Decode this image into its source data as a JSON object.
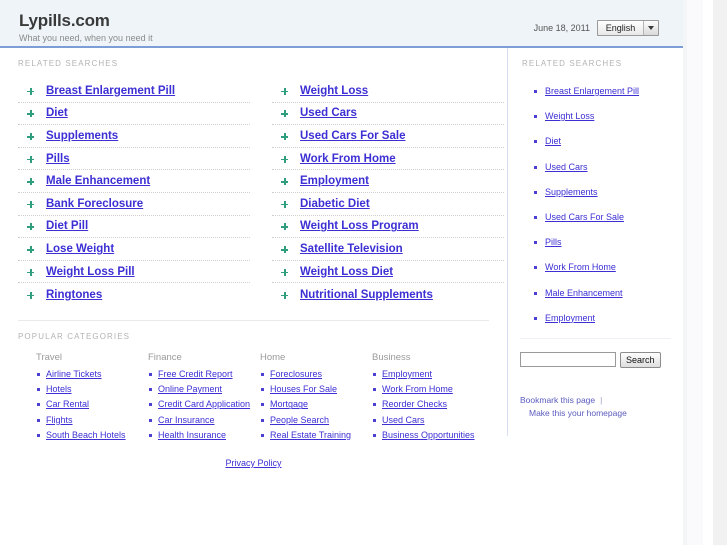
{
  "header": {
    "site_title": "Lypills.com",
    "tagline": "What you need, when you need it",
    "date": "June 18, 2011",
    "language": "English",
    "language_options": [
      "English"
    ]
  },
  "related_searches": {
    "label": "RELATED SEARCHES",
    "column_left": [
      "Breast Enlargement Pill",
      "Diet",
      "Supplements",
      "Pills",
      "Male Enhancement",
      "Bank Foreclosure",
      "Diet Pill",
      "Lose Weight",
      "Weight Loss Pill",
      "Ringtones"
    ],
    "column_right": [
      "Weight Loss",
      "Used Cars",
      "Used Cars For Sale",
      "Work From Home",
      "Employment",
      "Diabetic Diet",
      "Weight Loss Program",
      "Satellite Television",
      "Weight Loss Diet",
      "Nutritional Supplements"
    ]
  },
  "popular_categories": {
    "label": "POPULAR CATEGORIES",
    "groups": [
      {
        "title": "Travel",
        "items": [
          "Airline Tickets",
          "Hotels",
          "Car Rental",
          "Flights",
          "South Beach Hotels"
        ]
      },
      {
        "title": "Finance",
        "items": [
          "Free Credit Report",
          "Online Payment",
          "Credit Card Application",
          "Car Insurance",
          "Health Insurance"
        ]
      },
      {
        "title": "Home",
        "items": [
          "Foreclosures",
          "Houses For Sale",
          "Mortgage",
          "People Search",
          "Real Estate Training"
        ]
      },
      {
        "title": "Business",
        "items": [
          "Employment",
          "Work From Home",
          "Reorder Checks",
          "Used Cars",
          "Business Opportunities"
        ]
      }
    ]
  },
  "sidebar": {
    "label": "RELATED SEARCHES",
    "items": [
      "Breast Enlargement Pill",
      "Weight Loss",
      "Diet",
      "Used Cars",
      "Supplements",
      "Used Cars For Sale",
      "Pills",
      "Work From Home",
      "Male Enhancement",
      "Employment"
    ],
    "search": {
      "value": "",
      "placeholder": "",
      "button_label": "Search"
    },
    "bookmark_label": "Bookmark this page",
    "homepage_label": "Make this your homepage"
  },
  "footer": {
    "privacy_label": "Privacy Policy"
  },
  "colors": {
    "header_background": "#eef4f7",
    "header_border": "#7d9dd6",
    "link": "#3c2fd4",
    "plus_bullet": "#2f9e7e",
    "label_text": "#b3b3b3"
  }
}
